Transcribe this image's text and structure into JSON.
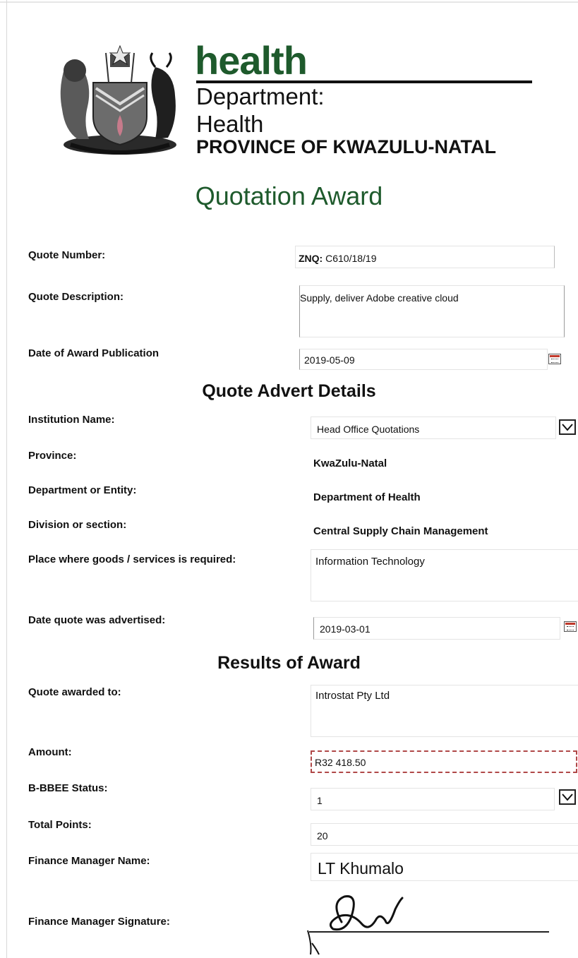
{
  "header": {
    "brand_word": "health",
    "department_label": "Department:",
    "department_name": "Health",
    "province": "PROVINCE OF KWAZULU-NATAL"
  },
  "title": "Quotation Award",
  "quote": {
    "number_label": "Quote Number:",
    "number_prefix": "ZNQ:",
    "number_value": "C610/18/19",
    "description_label": "Quote Description:",
    "description_value": "Supply, deliver  Adobe creative cloud",
    "award_date_label": "Date of Award Publication",
    "award_date_value": "2019-05-09"
  },
  "advert": {
    "heading": "Quote Advert Details",
    "institution_label": "Institution Name:",
    "institution_value": "Head Office Quotations",
    "province_label": "Province:",
    "province_value": "KwaZulu-Natal",
    "department_label": "Department or Entity:",
    "department_value": "Department of Health",
    "division_label": "Division or section:",
    "division_value": "Central Supply Chain Management",
    "place_label": "Place where goods /  services is required:",
    "place_value": "Information Technology",
    "advertised_label": "Date quote was advertised:",
    "advertised_value": "2019-03-01"
  },
  "results": {
    "heading": "Results of Award",
    "awarded_label": "Quote awarded to:",
    "awarded_value": "Introstat Pty Ltd",
    "amount_label": "Amount:",
    "amount_value": "R32 418.50",
    "bbbee_label": "B-BBEE Status:",
    "bbbee_value": "1",
    "points_label": "Total Points:",
    "points_value": "20",
    "fm_name_label": "Finance Manager Name:",
    "fm_name_value": "LT Khumalo",
    "fm_signature_label": "Finance Manager Signature:"
  },
  "icons": {
    "calendar": "calendar-icon",
    "dropdown": "chevron-down-icon",
    "crest": "coat-of-arms-icon"
  },
  "colors": {
    "brand_green": "#1e5a2c",
    "amount_border": "#b04848"
  }
}
